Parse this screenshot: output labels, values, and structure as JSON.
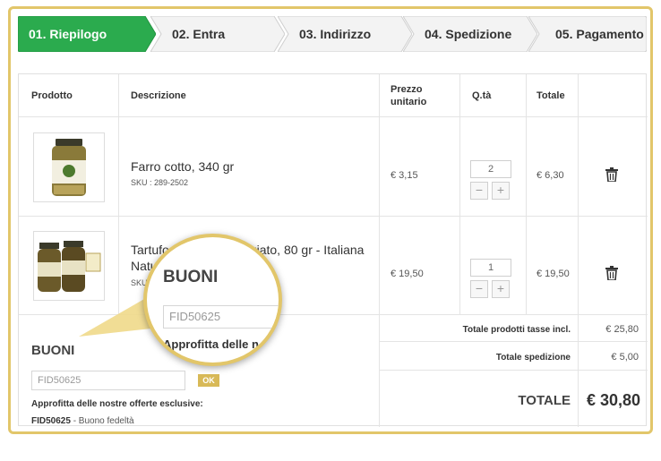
{
  "steps": [
    {
      "label": "01. Riepilogo",
      "active": true
    },
    {
      "label": "02. Entra",
      "active": false
    },
    {
      "label": "03. Indirizzo",
      "active": false
    },
    {
      "label": "04. Spedizione",
      "active": false
    },
    {
      "label": "05. Pagamento",
      "active": false
    }
  ],
  "colors": {
    "active_step": "#2bab4e",
    "accent_gold": "#e2c66a",
    "ok_button": "#d8b957"
  },
  "table": {
    "headers": {
      "product": "Prodotto",
      "description": "Descrizione",
      "unit_price_line1": "Prezzo",
      "unit_price_line2": "unitario",
      "qty": "Q.tà",
      "total": "Totale"
    },
    "rows": [
      {
        "name": "Farro cotto, 340 gr",
        "sku": "SKU : 289-2502",
        "unit_price": "€ 3,15",
        "qty": "2",
        "total": "€ 6,30",
        "icon": "trash-icon"
      },
      {
        "name_line1": "Tartufo",
        "name_line1_rest": "giato, 80 gr - Italiana",
        "name_line2": "Natu",
        "sku": "SKU",
        "unit_price": "€ 19,50",
        "qty": "1",
        "total": "€ 19,50",
        "icon": "trash-icon"
      }
    ],
    "qty_minus": "−",
    "qty_plus": "+"
  },
  "buoni": {
    "title": "BUONI",
    "code_value": "FID50625",
    "ok_label": "OK",
    "offer_title": "Approfitta delle nostre offerte esclusive:",
    "offer_code": "FID50625",
    "offer_desc": " - Buono fedeltà"
  },
  "summary": {
    "products_label": "Totale prodotti tasse incl.",
    "products_value": "€ 25,80",
    "shipping_label": "Totale spedizione",
    "shipping_value": "€ 5,00",
    "total_label": "TOTALE",
    "total_value": "€ 30,80"
  },
  "magnifier": {
    "title": "BUONI",
    "code_value": "FID50625",
    "offer_partial": "Approfitta delle n"
  }
}
